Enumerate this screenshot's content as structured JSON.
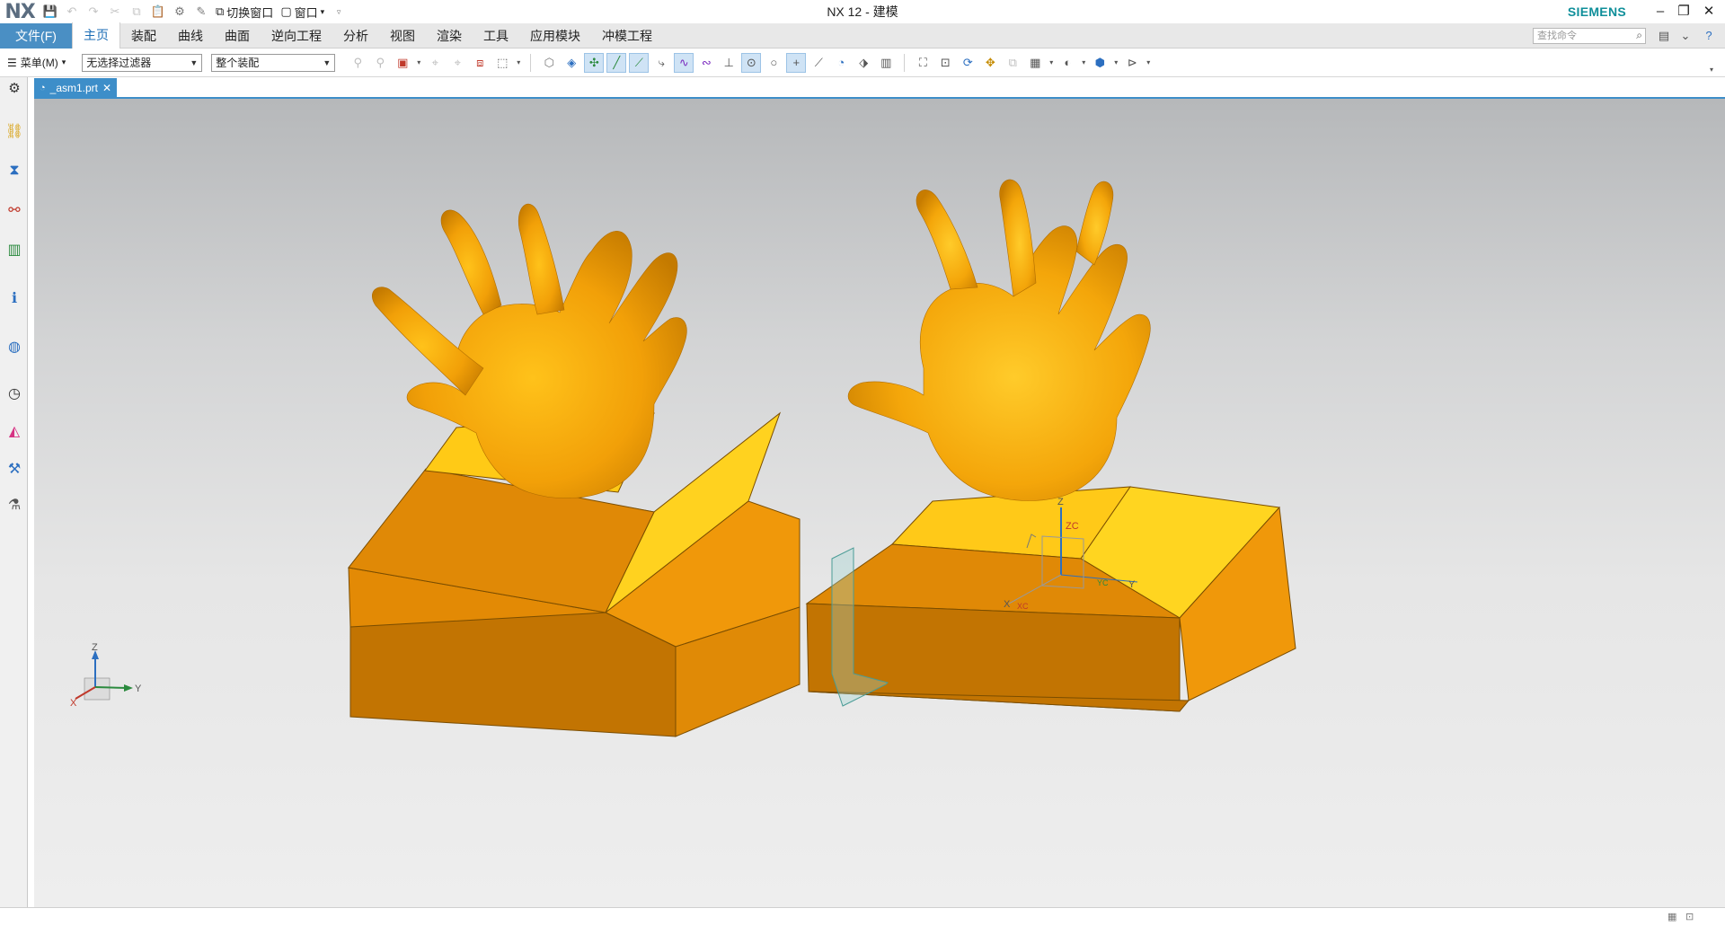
{
  "app": {
    "logo": "NX",
    "title": "NX 12 - 建模",
    "brand": "SIEMENS",
    "quick_access": {
      "switch_window": "切换窗口",
      "window": "窗口"
    }
  },
  "ribbon": {
    "file_tab": "文件(F)",
    "tabs": [
      "主页",
      "装配",
      "曲线",
      "曲面",
      "逆向工程",
      "分析",
      "视图",
      "渲染",
      "工具",
      "应用模块",
      "冲模工程"
    ],
    "active_tab": "主页",
    "search_placeholder": "查找命令"
  },
  "toolbar": {
    "menu_label": "菜单(M)",
    "filter_value": "无选择过滤器",
    "scope_value": "整个装配"
  },
  "document": {
    "tab_label": "_asm1.prt"
  },
  "viewport": {
    "triad_labels": {
      "x": "X",
      "y": "Y",
      "z": "Z"
    },
    "csys_labels": {
      "z": "Z",
      "zc": "ZC",
      "x": "X",
      "xc": "XC",
      "y": "Y",
      "yc": "YC"
    }
  },
  "colors": {
    "accent": "#4a8fc4",
    "brand": "#0f8f9a",
    "model_orange": "#f2a008"
  },
  "icons": {
    "resource_bar": [
      "settings-icon",
      "assembly-navigator-icon",
      "constraint-navigator-icon",
      "part-navigator-icon",
      "reuse-library-icon",
      "hd3d-tools-icon",
      "web-browser-icon",
      "history-icon",
      "visualization-icon",
      "process-studio-icon",
      "manufacturing-wizard-icon"
    ]
  }
}
